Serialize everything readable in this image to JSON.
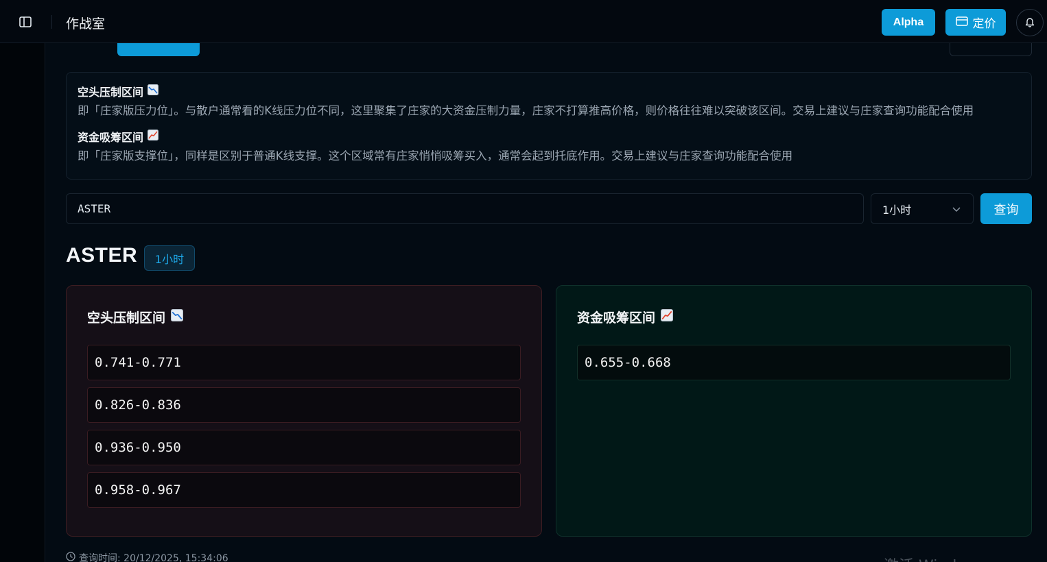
{
  "header": {
    "app_title": "作战室",
    "alpha_label": "Alpha",
    "pricing_label": "定价"
  },
  "info": {
    "resistance_title": "空头压制区间",
    "resistance_desc": "即「庄家版压力位」。与散户通常看的K线压力位不同，这里聚集了庄家的大资金压制力量，庄家不打算推高价格，则价格往往难以突破该区间。交易上建议与庄家查询功能配合使用",
    "support_title": "资金吸筹区间",
    "support_desc": "即「庄家版支撑位」，同样是区别于普通K线支撑。这个区域常有庄家悄悄吸筹买入，通常会起到托底作用。交易上建议与庄家查询功能配合使用"
  },
  "search": {
    "value": "ASTER",
    "timeframe": "1小时",
    "query_label": "查询"
  },
  "result": {
    "symbol": "ASTER",
    "timeframe": "1小时",
    "resistance_title": "空头压制区间",
    "resistance_zones": [
      "0.741-0.771",
      "0.826-0.836",
      "0.936-0.950",
      "0.958-0.967"
    ],
    "support_title": "资金吸筹区间",
    "support_zones": [
      "0.655-0.668"
    ],
    "query_time": "查询时间: 20/12/2025, 15:34:06"
  },
  "watermark": "激活 Windows",
  "icons": {
    "sidebar": "sidebar-toggle-icon",
    "pricing": "card-icon",
    "bell": "bell-icon",
    "down_chart": "chart-decreasing-icon",
    "up_chart": "chart-increasing-icon",
    "clock": "clock-icon",
    "chevron": "chevron-down-icon"
  },
  "colors": {
    "accent": "#0d9bd8",
    "resistance_card_bg": "#150f17",
    "resistance_border": "#3d1d22",
    "support_card_bg": "#011817",
    "support_border": "#0f312b"
  }
}
